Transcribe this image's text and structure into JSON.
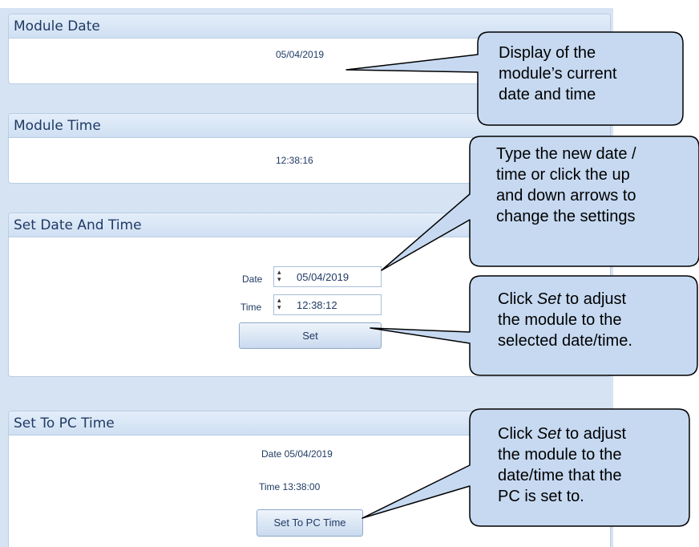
{
  "module_date": {
    "header": "Module Date",
    "value": "05/04/2019"
  },
  "module_time": {
    "header": "Module Time",
    "value": "12:38:16"
  },
  "set_date_time": {
    "header": "Set Date And Time",
    "date_label": "Date",
    "date_value": "05/04/2019",
    "time_label": "Time",
    "time_value": "12:38:12",
    "set_label": "Set"
  },
  "set_pc_time": {
    "header": "Set To PC Time",
    "date_text": "Date 05/04/2019",
    "time_text": "Time 13:38:00",
    "button_label": "Set To PC Time"
  },
  "callouts": {
    "display": [
      "Display of the",
      "module’s current",
      "date and time"
    ],
    "type": [
      "Type the new date /",
      "time or click the up",
      "and down arrows to",
      "change the settings"
    ],
    "set_line1_prefix": "Click ",
    "set_line1_em": "Set",
    "set_line1_suffix": " to adjust",
    "set_rest": [
      "the module to the",
      "selected date/time."
    ],
    "pc_line1_prefix": "Click ",
    "pc_line1_em": "Set",
    "pc_line1_suffix": " to adjust",
    "pc_rest": [
      "the module to the",
      "date/time that the",
      "PC is set to."
    ]
  },
  "colors": {
    "callout_fill": "#c6d9f1",
    "panel_header": "#dbe7f5",
    "background": "#d6e3f2"
  }
}
